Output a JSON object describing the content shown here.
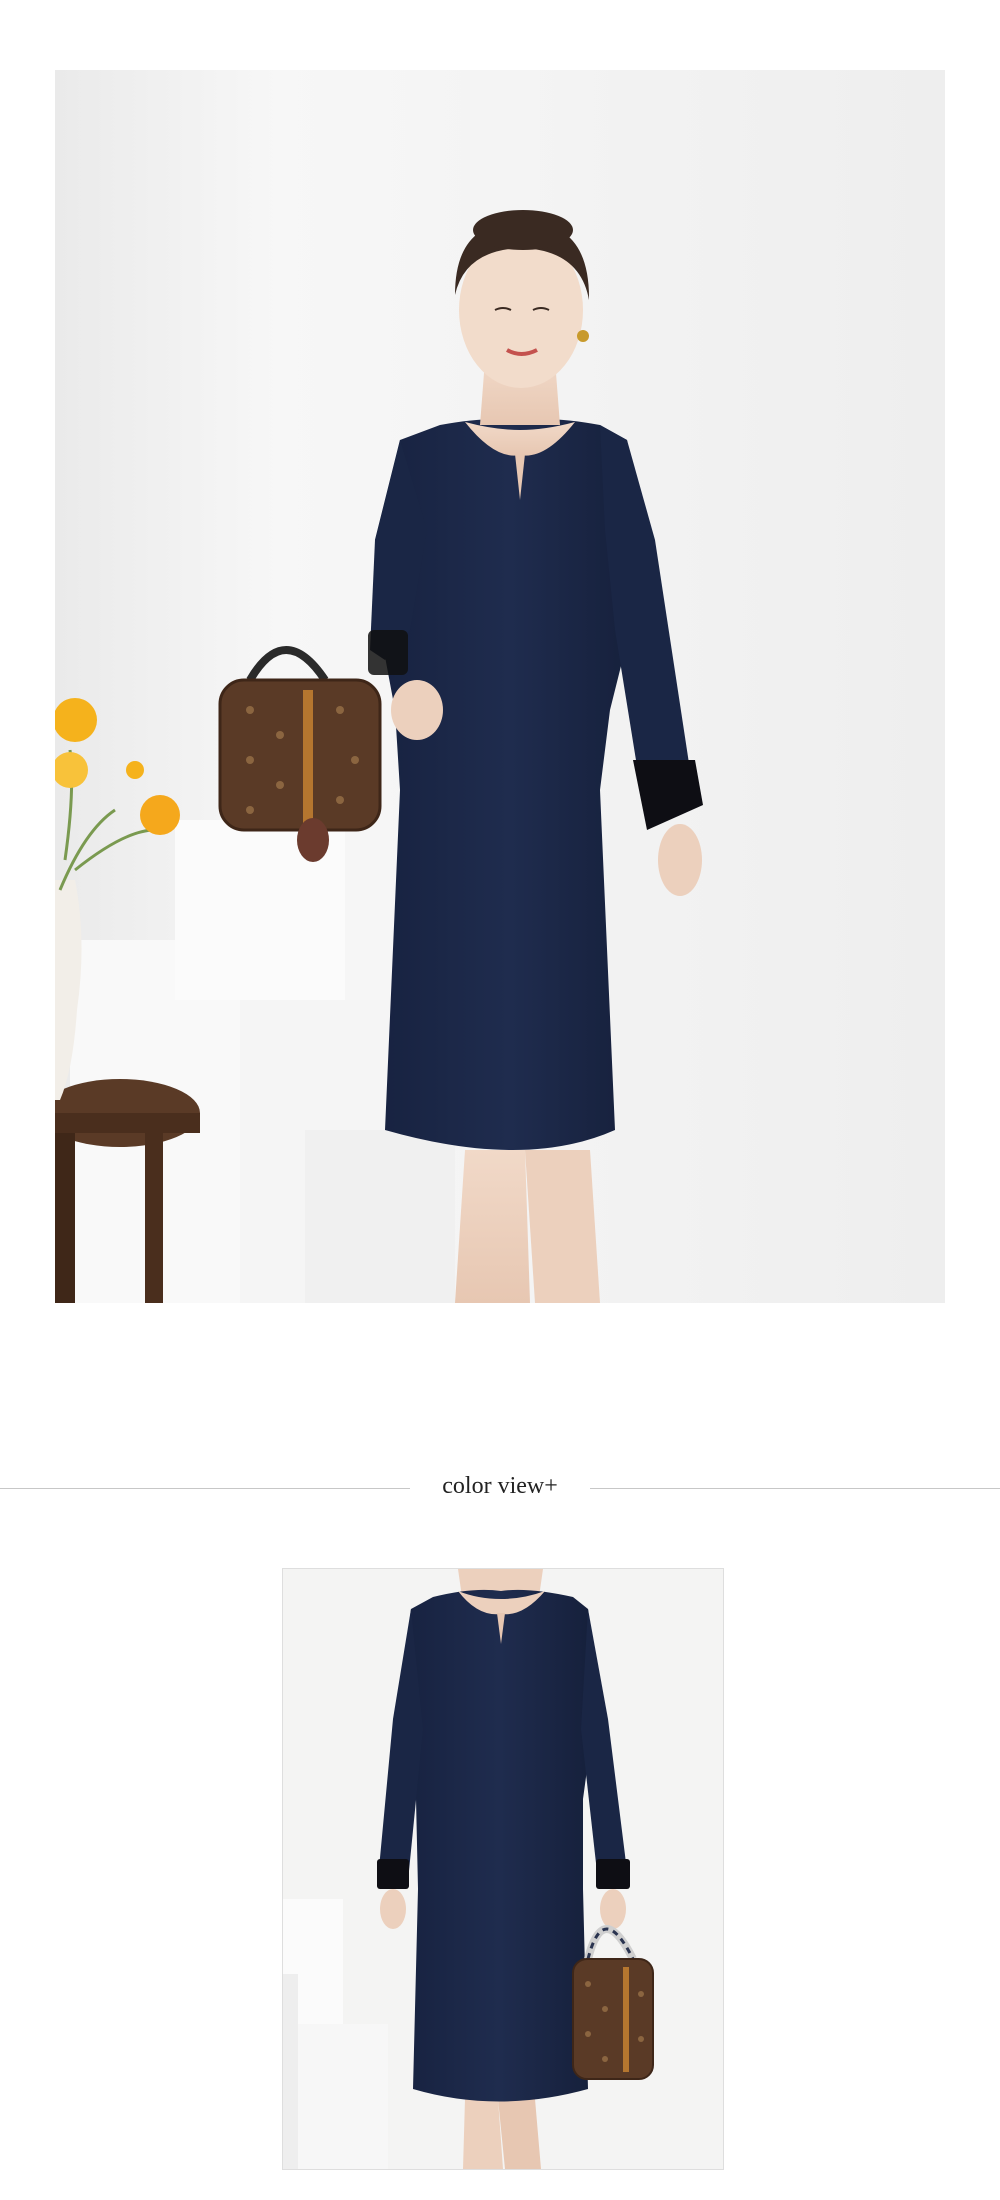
{
  "sections": {
    "color_view_title": "color view+"
  },
  "images": {
    "hero": {
      "name": "model-in-navy-dress-photo"
    },
    "color": {
      "name": "navy-dress-color-photo"
    }
  },
  "colors": {
    "dress_navy": "#1c2848",
    "background": "#f3f3f2",
    "divider": "#c7c7c7",
    "flower_yellow": "#f5b21c",
    "bag_brown": "#5a3a26"
  }
}
